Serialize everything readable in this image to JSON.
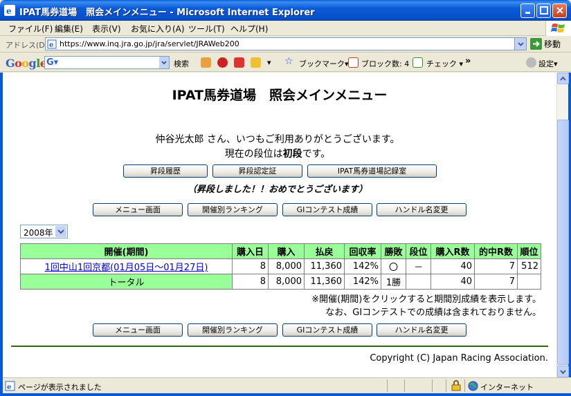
{
  "window": {
    "title": "IPAT馬券道場　照会メインメニュー - Microsoft Internet Explorer"
  },
  "menu": [
    "ファイル(F)",
    "編集(E)",
    "表示(V)",
    "お気に入り(A)",
    "ツール(T)",
    "ヘルプ(H)"
  ],
  "address": {
    "label": "アドレス(D)",
    "url": "https://www.inq.jra.go.jp/jra/servlet/JRAWeb200",
    "go": "移動"
  },
  "gtoolbar": {
    "logo": "Google",
    "search_label": "検索",
    "bookmark": "ブックマーク▾",
    "block": "ブロック数: 4",
    "check": "チェック ▾",
    "more": "»",
    "settings": "設定▾"
  },
  "page": {
    "title": "IPAT馬券道場　照会メインメニュー",
    "greeting": "仲谷光太郎 さん、いつもご利用ありがとうございます。",
    "dan_prefix": "現在の段位は",
    "dan_value": "初段",
    "dan_suffix": "です。",
    "top_buttons": [
      "昇段履歴",
      "昇段認定証",
      "IPAT馬券道場記録室"
    ],
    "congrats": "（昇段しました！！おめでとうございます）",
    "nav_buttons": [
      "メニュー画面",
      "開催別ランキング",
      "GIコンテスト成績",
      "ハンドル名変更"
    ],
    "year": "2008年"
  },
  "table": {
    "headers": [
      "開催(期間)",
      "購入日",
      "購入",
      "払戻",
      "回収率",
      "勝敗",
      "段位",
      "購入R数",
      "的中R数",
      "順位"
    ],
    "rows": [
      {
        "period": "1回中山1回京都(01月05日～01月27日)",
        "days": "8",
        "buy": "8,000",
        "pay": "11,360",
        "rate": "142%",
        "winloss": "〇",
        "dan": "－",
        "buyR": "40",
        "hitR": "7",
        "rank": "512"
      }
    ],
    "total": {
      "label": "トータル",
      "days": "8",
      "buy": "8,000",
      "pay": "11,360",
      "rate": "142%",
      "winloss": "1勝",
      "dan": "",
      "buyR": "40",
      "hitR": "7",
      "rank": ""
    }
  },
  "notes": [
    "※開催(期間)をクリックすると期間別成績を表示します。",
    "なお、GIコンテストでの成績は含まれておりません。"
  ],
  "copyright": "Copyright (C) Japan Racing Association.",
  "status": {
    "text": "ページが表示されました",
    "zone": "インターネット"
  },
  "colors": {
    "header_green": "#99ff99",
    "titlebar_blue": "#0a5ad8",
    "rule_green": "#336600"
  }
}
